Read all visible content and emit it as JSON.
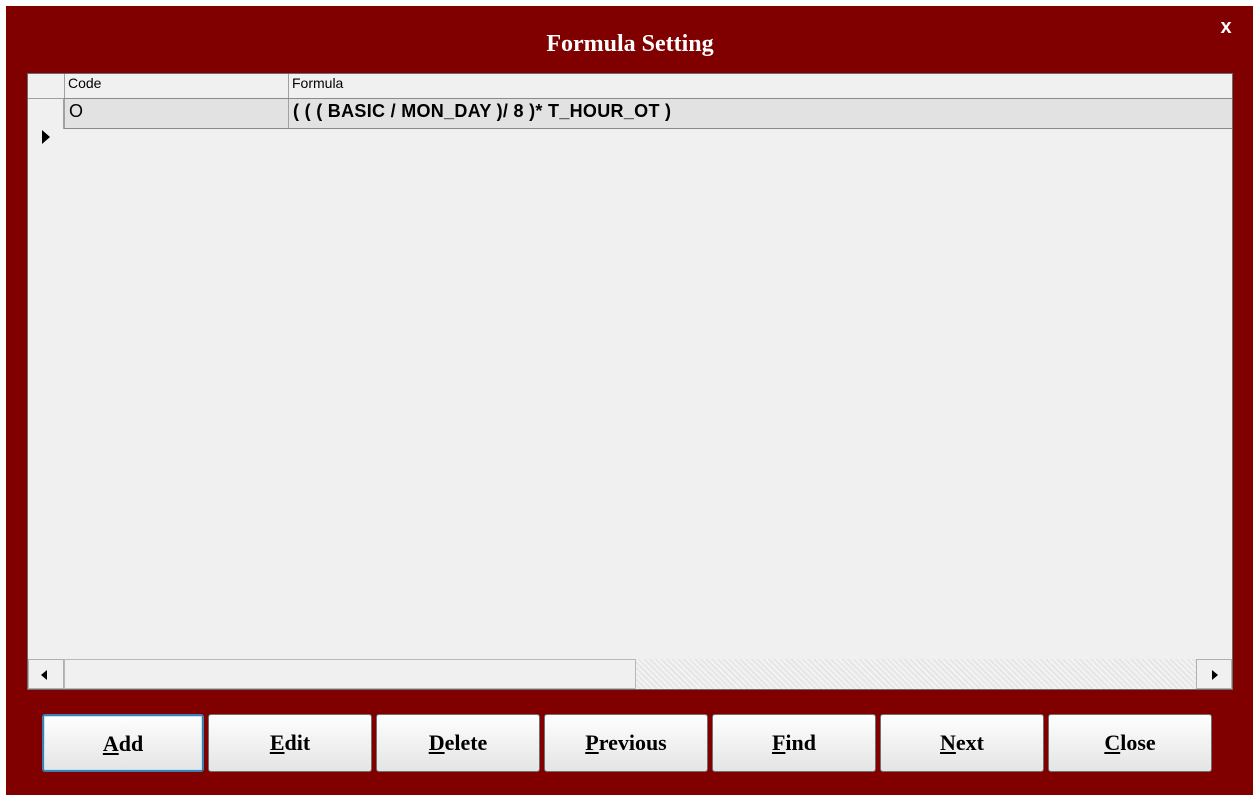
{
  "window": {
    "title": "Formula Setting",
    "close_label": "x"
  },
  "grid": {
    "columns": [
      "Code",
      "Formula"
    ],
    "rows": [
      {
        "code": "O",
        "formula": "( ( ( BASIC / MON_DAY )/ 8 )* T_HOUR_OT )"
      }
    ]
  },
  "buttons": [
    {
      "mnemonic": "A",
      "rest": "dd"
    },
    {
      "mnemonic": "E",
      "rest": "dit"
    },
    {
      "mnemonic": "D",
      "rest": "elete"
    },
    {
      "mnemonic": "P",
      "rest": "revious"
    },
    {
      "mnemonic": "F",
      "rest": "ind"
    },
    {
      "mnemonic": "N",
      "rest": "ext"
    },
    {
      "mnemonic": "C",
      "rest": "lose"
    }
  ],
  "colors": {
    "window_bg": "#800000",
    "title_text": "#ffffff",
    "grid_bg": "#f0f0f0",
    "selected_row_bg": "#e2e2e2",
    "default_button_border": "#3c7fb1"
  }
}
